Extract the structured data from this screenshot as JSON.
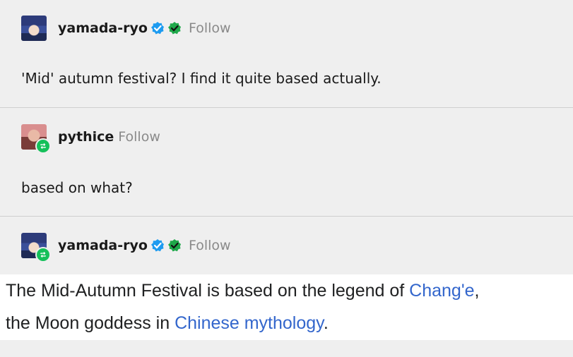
{
  "posts": [
    {
      "username": "yamada-ryo",
      "follow_label": "Follow",
      "avatar": "anime-girl-blue-hair-avatar",
      "badges": [
        "blue-verified-icon",
        "green-verified-icon"
      ],
      "text": "'Mid' autumn festival? I find it quite based actually."
    },
    {
      "username": "pythice",
      "follow_label": "Follow",
      "avatar": "pink-avatar",
      "reblog_badge": "reblog-icon",
      "text": "based on what?"
    },
    {
      "username": "yamada-ryo",
      "follow_label": "Follow",
      "avatar": "anime-girl-blue-hair-avatar",
      "reblog_badge": "reblog-icon",
      "badges": [
        "blue-verified-icon",
        "green-verified-icon"
      ]
    }
  ],
  "wiki_excerpt": {
    "line1_text": "The Mid-Autumn Festival is based on the legend of ",
    "line1_link": "Chang'e",
    "line1_tail": ",",
    "line2_text": "the Moon goddess in ",
    "line2_link": "Chinese mythology",
    "line2_tail": "."
  },
  "colors": {
    "background": "#efefef",
    "link": "#3366cc",
    "follow": "#8a8a8a",
    "verified_blue": "#1d9bf0",
    "verified_green": "#1fa84a",
    "reblog_green": "#15c05a"
  }
}
